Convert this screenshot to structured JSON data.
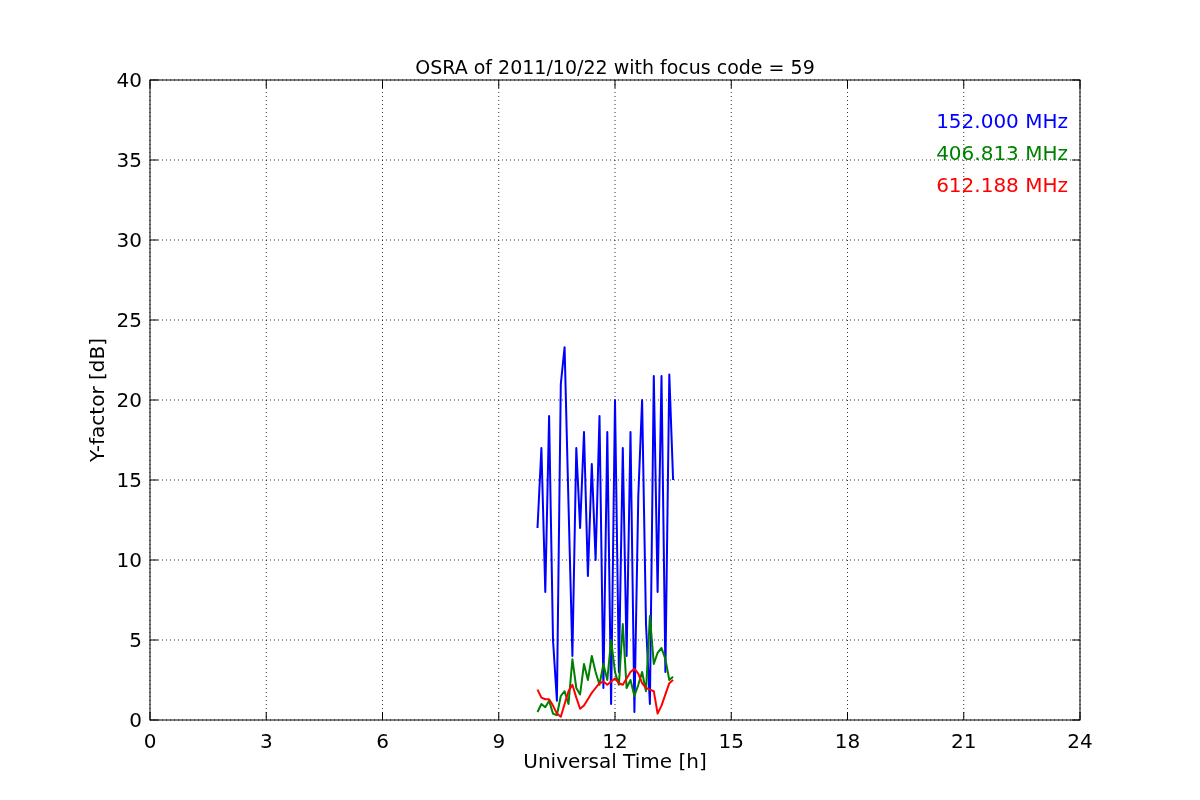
{
  "figure": {
    "chart_data": {
      "type": "line",
      "title": "OSRA of 2011/10/22 with focus code = 59",
      "xlabel": "Universal Time [h]",
      "ylabel": "Y-factor [dB]",
      "x": [
        10.0,
        10.1,
        10.2,
        10.3,
        10.4,
        10.5,
        10.6,
        10.7,
        10.8,
        10.9,
        11.0,
        11.1,
        11.2,
        11.3,
        11.4,
        11.5,
        11.6,
        11.7,
        11.8,
        11.9,
        12.0,
        12.1,
        12.2,
        12.3,
        12.4,
        12.5,
        12.6,
        12.7,
        12.8,
        12.9,
        13.0,
        13.1,
        13.2,
        13.3,
        13.4,
        13.5
      ],
      "series": [
        {
          "name": "152.000 MHz",
          "color": "#0000ff",
          "values": [
            12,
            17,
            8,
            19,
            5,
            1.2,
            21,
            23.3,
            13.5,
            4,
            17,
            12,
            18,
            9,
            16,
            10,
            19,
            2,
            18,
            1,
            20,
            3,
            17,
            4,
            18,
            0.5,
            14,
            20,
            6,
            1,
            21.5,
            8,
            21.5,
            3,
            21.6,
            15
          ]
        },
        {
          "name": "406.813 MHz",
          "color": "#008000",
          "values": [
            0.5,
            1,
            0.8,
            1.2,
            0.4,
            0.3,
            1.5,
            1.8,
            1,
            3.8,
            2,
            1.6,
            3.5,
            2.5,
            4,
            3,
            2.2,
            3.5,
            2.5,
            5,
            3,
            2.2,
            6,
            2,
            2.5,
            1.5,
            2.2,
            3,
            1.8,
            6.5,
            3.5,
            4.2,
            4.5,
            3.8,
            2.5,
            2.7
          ]
        },
        {
          "name": "612.188 MHz",
          "color": "#ff0000",
          "values": [
            1.9,
            1.4,
            1.3,
            1.3,
            0.9,
            0.4,
            0.2,
            1.0,
            1.8,
            2.2,
            1.4,
            0.7,
            0.9,
            1.3,
            1.7,
            2.0,
            2.3,
            2.4,
            2.2,
            2.4,
            2.6,
            2.3,
            2.2,
            2.6,
            3.0,
            3.2,
            2.9,
            2.3,
            2.0,
            1.9,
            1.8,
            0.4,
            0.9,
            1.6,
            2.3,
            2.5
          ]
        }
      ],
      "xlim": [
        0,
        24
      ],
      "ylim": [
        0,
        40
      ],
      "xticks": [
        0,
        3,
        6,
        9,
        12,
        15,
        18,
        21,
        24
      ],
      "yticks": [
        0,
        5,
        10,
        15,
        20,
        25,
        30,
        35,
        40
      ],
      "grid": true
    }
  }
}
